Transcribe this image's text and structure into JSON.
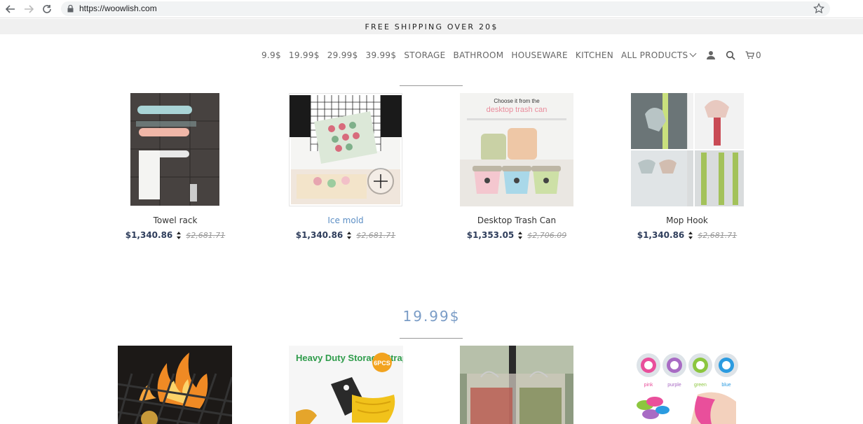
{
  "browser": {
    "url": "https://woowlish.com"
  },
  "announcement": "FREE SHIPPING OVER 20$",
  "nav": {
    "items": [
      "9.9$",
      "19.99$",
      "29.99$",
      "39.99$",
      "STORAGE",
      "BATHROOM",
      "HOUSEWARE",
      "KITCHEN",
      "ALL PRODUCTS"
    ],
    "cart_count": "0"
  },
  "products": [
    {
      "name": "Towel rack",
      "price": "$1,340.86",
      "old_price": "$2,681.71"
    },
    {
      "name": "Ice mold",
      "price": "$1,340.86",
      "old_price": "$2,681.71"
    },
    {
      "name": "Desktop Trash Can",
      "price": "$1,353.05",
      "old_price": "$2,706.09"
    },
    {
      "name": "Mop Hook",
      "price": "$1,340.86",
      "old_price": "$2,681.71"
    }
  ],
  "section2": {
    "title": "19.99$",
    "images": {
      "straps_title": "Heavy Duty Storage Straps",
      "straps_badge": "6PCS",
      "color_labels": [
        "pink",
        "purple",
        "green",
        "blue"
      ]
    }
  },
  "trash_image": {
    "line1": "Choose it from the",
    "line2": "desktop trash can"
  },
  "colors": {
    "accent": "#7a9cc6",
    "price": "#2f3e5c",
    "link": "#5d8fc5"
  }
}
